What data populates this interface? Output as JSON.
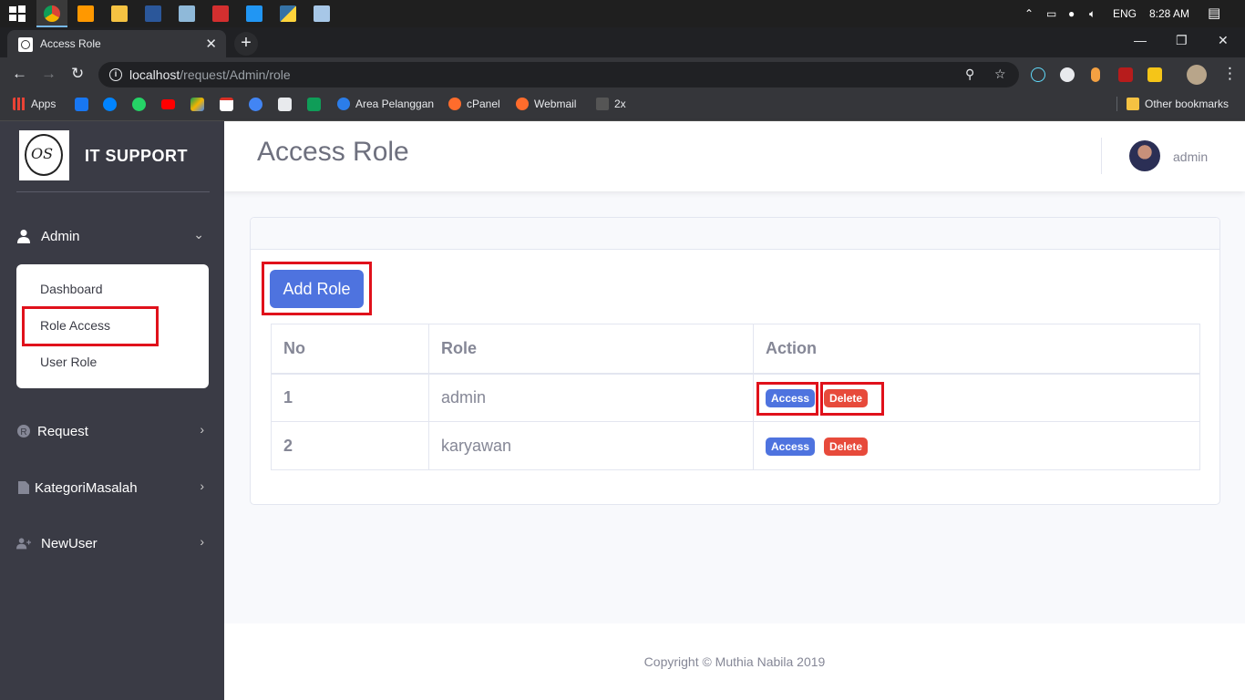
{
  "taskbar": {
    "apps": [
      "windows-start-icon",
      "chrome-icon",
      "sublime-icon",
      "file-explorer-icon",
      "word-icon",
      "paint-icon",
      "acrobat-icon",
      "vscode-icon",
      "python-icon",
      "notepad-icon"
    ],
    "language": "ENG",
    "time": "8:28 AM"
  },
  "browser": {
    "tab_title": "Access Role",
    "tab_close": "✕",
    "new_tab": "+",
    "url_host": "localhost",
    "url_path": "/request/Admin/role",
    "window_controls": [
      "—",
      "❐",
      "✕"
    ]
  },
  "bookmarks": {
    "apps_label": "Apps",
    "items": [
      "Area Pelanggan",
      "cPanel",
      "Webmail",
      "2x"
    ],
    "other": "Other bookmarks"
  },
  "sidebar": {
    "brand": "IT SUPPORT",
    "logo_text": "OS",
    "admin_label": "Admin",
    "submenu": [
      "Dashboard",
      "Role Access",
      "User Role"
    ],
    "menu": [
      "Request",
      "KategoriMasalah",
      "NewUser"
    ]
  },
  "topbar": {
    "title": "Access Role",
    "username": "admin"
  },
  "card": {
    "add_button": "Add Role",
    "headers": [
      "No",
      "Role",
      "Action"
    ],
    "rows": [
      {
        "no": "1",
        "role": "admin",
        "access": "Access",
        "delete": "Delete"
      },
      {
        "no": "2",
        "role": "karyawan",
        "access": "Access",
        "delete": "Delete"
      }
    ]
  },
  "footer": {
    "copyright": "Copyright © Muthia Nabila 2019"
  },
  "colors": {
    "primary": "#4e73df",
    "danger": "#e74a3b",
    "sidebar": "#3a3b45",
    "highlight": "#e0111b"
  }
}
